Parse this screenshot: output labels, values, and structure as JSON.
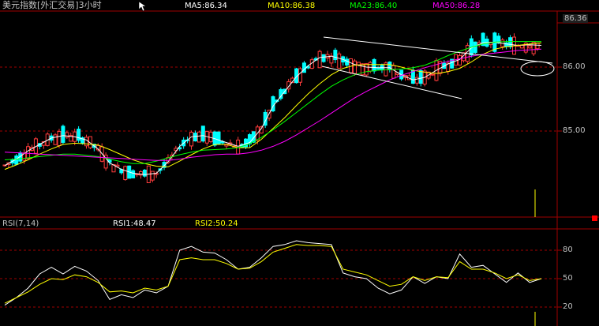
{
  "header": {
    "title": "美元指数[外汇交易]3小时",
    "ma5": "MA5:86.34",
    "ma10": "MA10:86.38",
    "ma23": "MA23:86.40",
    "ma50": "MA50:86.28"
  },
  "rsi_header": {
    "name": "RSI(7,14)",
    "rsi1": "RSI1:48.47",
    "rsi2": "RSI2:50.24"
  },
  "price_axis": {
    "last": "86.36",
    "ticks": [
      "86.00",
      "85.00"
    ]
  },
  "rsi_axis": {
    "ticks": [
      "80",
      "50",
      "20"
    ]
  },
  "colors": {
    "ma5": "#ffffff",
    "ma10": "#ffff00",
    "ma23": "#00ff00",
    "ma50": "#ff00ff",
    "up": "#ff3c3c",
    "down": "#00ffff",
    "grid": "#a00000",
    "rsi1": "#ffffff",
    "rsi2": "#ffff00"
  },
  "chart_data": [
    {
      "type": "candlestick",
      "title": "美元指数[外汇交易]3小时",
      "ylim": [
        84.1,
        86.45
      ],
      "grid_y": [
        86.0,
        85.0
      ],
      "series": [
        {
          "name": "MA5",
          "values": [
            84.46,
            84.56,
            84.69,
            84.79,
            84.89,
            84.93,
            84.91,
            84.86,
            84.72,
            84.5,
            84.4,
            84.34,
            84.32,
            84.34,
            84.52,
            84.76,
            84.91,
            84.93,
            84.88,
            84.82,
            84.76,
            84.82,
            85.04,
            85.39,
            85.62,
            85.85,
            86.02,
            86.15,
            86.17,
            86.12,
            86.04,
            86.0,
            85.99,
            85.99,
            85.88,
            85.8,
            85.84,
            85.95,
            86.05,
            86.12,
            86.3,
            86.38,
            86.39,
            86.36,
            86.34,
            86.35,
            86.34
          ]
        },
        {
          "name": "MA10",
          "values": [
            84.4,
            84.47,
            84.55,
            84.64,
            84.72,
            84.79,
            84.81,
            84.8,
            84.78,
            84.71,
            84.63,
            84.55,
            84.49,
            84.45,
            84.44,
            84.53,
            84.63,
            84.72,
            84.79,
            84.79,
            84.74,
            84.74,
            84.87,
            85.04,
            85.21,
            85.4,
            85.58,
            85.74,
            85.88,
            85.98,
            86.03,
            86.04,
            86.04,
            86.04,
            86.0,
            85.95,
            85.92,
            85.9,
            85.93,
            85.98,
            86.08,
            86.2,
            86.28,
            86.32,
            86.34,
            86.36,
            86.38
          ]
        },
        {
          "name": "MA23",
          "values": [
            84.55,
            84.56,
            84.58,
            84.6,
            84.62,
            84.64,
            84.64,
            84.62,
            84.6,
            84.56,
            84.52,
            84.49,
            84.49,
            84.53,
            84.58,
            84.63,
            84.67,
            84.7,
            84.71,
            84.72,
            84.74,
            84.8,
            84.9,
            85.02,
            85.15,
            85.29,
            85.43,
            85.57,
            85.7,
            85.8,
            85.88,
            85.93,
            85.95,
            85.96,
            85.97,
            85.99,
            86.03,
            86.1,
            86.18,
            86.25,
            86.31,
            86.36,
            86.39,
            86.4,
            86.4,
            86.4,
            86.4
          ]
        },
        {
          "name": "MA50",
          "values": [
            84.67,
            84.66,
            84.65,
            84.64,
            84.63,
            84.62,
            84.61,
            84.6,
            84.59,
            84.58,
            84.57,
            84.56,
            84.55,
            84.54,
            84.54,
            84.56,
            84.59,
            84.61,
            84.63,
            84.64,
            84.64,
            84.66,
            84.7,
            84.76,
            84.84,
            84.94,
            85.05,
            85.16,
            85.28,
            85.4,
            85.52,
            85.62,
            85.71,
            85.8,
            85.87,
            85.93,
            85.99,
            86.04,
            86.09,
            86.13,
            86.17,
            86.2,
            86.22,
            86.24,
            86.26,
            86.27,
            86.28
          ]
        }
      ]
    },
    {
      "type": "line",
      "title": "RSI(7,14)",
      "ylim": [
        0,
        100
      ],
      "grid_y": [
        80,
        50,
        20
      ],
      "series": [
        {
          "name": "RSI1",
          "values": [
            22,
            30,
            40,
            55,
            62,
            55,
            63,
            58,
            48,
            28,
            33,
            30,
            38,
            35,
            42,
            80,
            84,
            78,
            77,
            70,
            60,
            62,
            72,
            84,
            86,
            90,
            88,
            87,
            86,
            56,
            52,
            50,
            40,
            34,
            38,
            52,
            45,
            52,
            50,
            76,
            62,
            64,
            55,
            46,
            56,
            46,
            50
          ]
        },
        {
          "name": "RSI2",
          "values": [
            24,
            30,
            36,
            44,
            50,
            49,
            54,
            52,
            46,
            36,
            37,
            35,
            40,
            38,
            42,
            70,
            72,
            70,
            70,
            66,
            60,
            61,
            68,
            78,
            82,
            86,
            85,
            85,
            84,
            60,
            57,
            54,
            48,
            42,
            44,
            52,
            48,
            52,
            51,
            68,
            60,
            60,
            56,
            50,
            54,
            48,
            50
          ]
        }
      ]
    }
  ]
}
